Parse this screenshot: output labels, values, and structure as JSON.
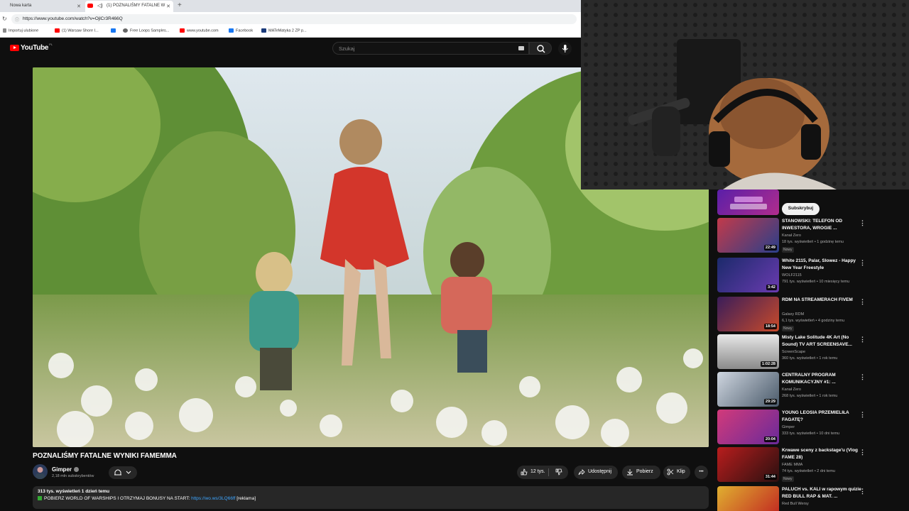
{
  "browser": {
    "tabs": [
      {
        "title": "Nowa karta"
      },
      {
        "title": "(1) POZNALIŚMY FATALNE W"
      }
    ],
    "url": "https://www.youtube.com/watch?v=OjlCr3R466Q",
    "bookmarks": [
      {
        "label": "Importuj ulubione",
        "color": "#5f6368"
      },
      {
        "label": "(1) Warsaw Shore I...",
        "color": "#ff0000"
      },
      {
        "label": "",
        "color": "#1877f2"
      },
      {
        "label": "Free Loops Samples...",
        "color": "#666666"
      },
      {
        "label": "www.youtube.com",
        "color": "#ff0000"
      },
      {
        "label": "Facebook",
        "color": "#1877f2"
      },
      {
        "label": "MATeMatyka 2 ZP p...",
        "color": "#1a3a7a"
      }
    ]
  },
  "header": {
    "logo_text": "YouTube",
    "logo_country": "PL",
    "search_placeholder": "Szukaj"
  },
  "video": {
    "title": "POZNALIŚMY FATALNE WYNIKI FAMEMMA",
    "channel": "Gimper",
    "subscribers": "2,18 mln subskrybentów",
    "likes": "12 tys.",
    "share_label": "Udostępnij",
    "download_label": "Pobierz",
    "clip_label": "Klip",
    "more_label": "•••"
  },
  "description": {
    "stats": "313 tys. wyświetleń  1 dzień temu",
    "line_text": "POBIERZ WORLD OF WARSHIPS I OTRZYMAJ BONUSY NA START:",
    "link": "https://wo.ws/3LQ66ff",
    "ad_tag": "[reklama]"
  },
  "ad": {
    "subscribe_label": "Subskrybuj"
  },
  "recommendations": [
    {
      "title": "STANOWSKI: TELEFON OD INWESTORA, WROGIE ...",
      "channel": "Kanał Zero",
      "meta": "18 tys. wyświetleń • 1 godzinę temu",
      "badge": "Nowy",
      "duration": "22:49",
      "thumb_a": "#c23a4a",
      "thumb_b": "#2a3f8a"
    },
    {
      "title": "White 2115, Palar, Slowez - Happy New Year Freestyle",
      "channel": "WOLF2115",
      "meta": "791 tys. wyświetleń • 10 miesięcy temu",
      "badge": "",
      "duration": "3:42",
      "thumb_a": "#1b2a6b",
      "thumb_b": "#6a3bb0"
    },
    {
      "title": "RDM NA STREAMERACH FIVEM",
      "channel": "Galaxy RDM",
      "meta": "6,1 tys. wyświetleń • 4 godziny temu",
      "badge": "Nowy",
      "duration": "18:54",
      "thumb_a": "#3a1d5a",
      "thumb_b": "#c84a2a"
    },
    {
      "title": "Misty Lake Solitude 4K Art (No Sound) TV ART SCREENSAVE...",
      "channel": "ScreenScape",
      "meta": "360 tys. wyświetleń • 1 rok temu",
      "badge": "",
      "duration": "1:02:28",
      "thumb_a": "#e8e8e8",
      "thumb_b": "#8a8a8a"
    },
    {
      "title": "CENTRALNY PROGRAM KOMUNIKACYJNY #1: ...",
      "channel": "Kanał Zero",
      "meta": "268 tys. wyświetleń • 1 rok temu",
      "badge": "",
      "duration": "29:29",
      "thumb_a": "#cfd6e0",
      "thumb_b": "#4a5a6a"
    },
    {
      "title": "YOUNG LEOSIA PRZEMIELIŁA FAGATĘ?",
      "channel": "Gimper",
      "meta": "333 tys. wyświetleń • 10 dni temu",
      "badge": "",
      "duration": "20:04",
      "thumb_a": "#d23a7a",
      "thumb_b": "#6a2a9a"
    },
    {
      "title": "Krwawe sceny z backstage'u (Vlog FAME 28)",
      "channel": "FAME MMA",
      "meta": "74 tys. wyświetleń • 2 dni temu",
      "badge": "Nowy",
      "duration": "31:44",
      "thumb_a": "#b81d1d",
      "thumb_b": "#2a1010"
    },
    {
      "title": "PALUCH vs. KALI w rapowym quizie RED BULL RAP & MAT. ...",
      "channel": "Red Bull Wersy",
      "meta": "",
      "badge": "",
      "duration": "",
      "thumb_a": "#e0b030",
      "thumb_b": "#c02020"
    }
  ]
}
